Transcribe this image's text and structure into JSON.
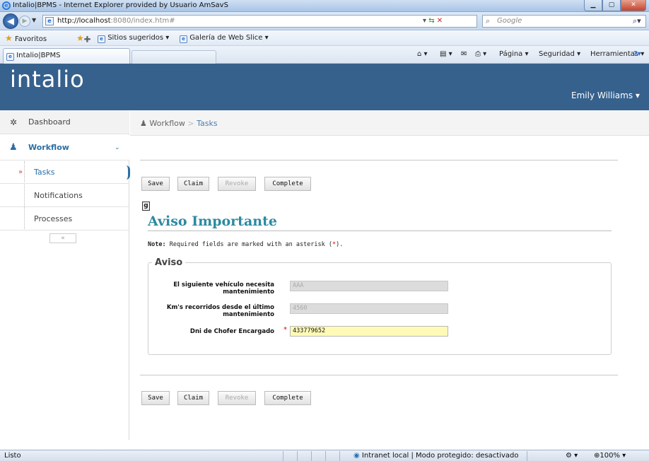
{
  "browser": {
    "window_title": "Intalio|BPMS - Internet Explorer provided by Usuario AmSavS",
    "url_host": "http://localhost",
    "url_rest": ":8080/index.htm#",
    "search_placeholder": "Google",
    "favorites_label": "Favoritos",
    "fav_links": [
      "Sitios sugeridos ▾",
      "Galería de Web Slice ▾"
    ],
    "tab_title": "Intalio|BPMS",
    "commands": [
      "Página ▾",
      "Seguridad ▾",
      "Herramientas ▾"
    ],
    "status_left": "Listo",
    "status_zone": "Intranet local | Modo protegido: desactivado",
    "zoom": "100%"
  },
  "app": {
    "logo": "intalio",
    "user": "Emily Williams"
  },
  "sidebar": {
    "items": [
      {
        "label": "Dashboard"
      },
      {
        "label": "Workflow"
      },
      {
        "label": "Tasks"
      },
      {
        "label": "Notifications"
      },
      {
        "label": "Processes"
      }
    ],
    "collapse": "«"
  },
  "breadcrumb": {
    "root": "Workflow",
    "sep": ">",
    "current": "Tasks"
  },
  "form": {
    "buttons": {
      "save": "Save",
      "claim": "Claim",
      "revoke": "Revoke",
      "complete": "Complete"
    },
    "title": "Aviso Importante",
    "note_bold": "Note:",
    "note_text": " Required fields are marked with an asterisk (",
    "note_ast": "*",
    "note_end": ").",
    "legend": "Aviso",
    "fields": [
      {
        "label": "El siguiente vehículo necesita mantenimiento",
        "value": "AAA",
        "required": false
      },
      {
        "label": "Km's recorridos desde el último mantenimiento",
        "value": "4560",
        "required": false
      },
      {
        "label": "Dni de Chofer Encargado",
        "value": "433779652",
        "required": true
      }
    ],
    "required_mark": "*"
  },
  "colors": {
    "header": "#36618d",
    "title": "#2c8aa0",
    "link": "#4a7cb0",
    "active_field": "#fffbb6"
  }
}
